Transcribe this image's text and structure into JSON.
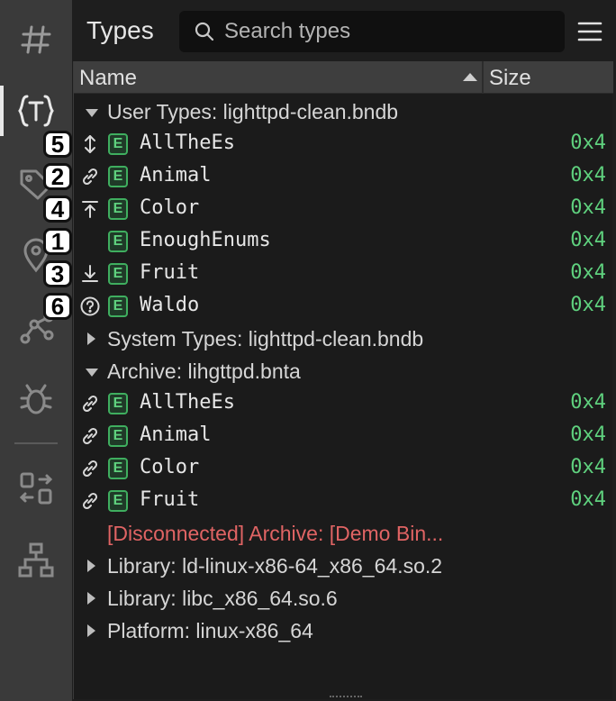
{
  "panel": {
    "title": "Types",
    "search_placeholder": "Search types",
    "menu_icon": "hamburger-menu-icon"
  },
  "rail": {
    "icons": [
      "hash-icon",
      "types-icon",
      "tag-icon",
      "location-pin-icon",
      "graph-nodes-icon",
      "bug-icon",
      "transfer-icon",
      "hierarchy-icon"
    ],
    "active": "types-icon"
  },
  "columns": {
    "name": "Name",
    "size": "Size",
    "sort": "ascending"
  },
  "groups": {
    "user": "User Types: lighttpd-clean.bndb",
    "system": "System Types: lighttpd-clean.bndb",
    "archive": "Archive: lihgttpd.bnta",
    "disconnected": "[Disconnected] Archive: [Demo Bin...",
    "lib1": "Library: ld-linux-x86-64_x86_64.so.2",
    "lib2": "Library: libc_x86_64.so.6",
    "platform": "Platform: linux-x86_64"
  },
  "user_types": [
    {
      "name": "AllTheEs",
      "size": "0x4",
      "status": "sync-both-icon",
      "kind": "E",
      "callout": "5"
    },
    {
      "name": "Animal",
      "size": "0x4",
      "status": "link-icon",
      "kind": "E",
      "callout": "2"
    },
    {
      "name": "Color",
      "size": "0x4",
      "status": "push-up-icon",
      "kind": "E",
      "callout": "4"
    },
    {
      "name": "EnoughEnums",
      "size": "0x4",
      "status": "",
      "kind": "E",
      "callout": "1"
    },
    {
      "name": "Fruit",
      "size": "0x4",
      "status": "pull-down-icon",
      "kind": "E",
      "callout": "3"
    },
    {
      "name": "Waldo",
      "size": "0x4",
      "status": "question-icon",
      "kind": "E",
      "callout": "6"
    }
  ],
  "archive_types": [
    {
      "name": "AllTheEs",
      "size": "0x4",
      "status": "link-icon",
      "kind": "E"
    },
    {
      "name": "Animal",
      "size": "0x4",
      "status": "link-icon",
      "kind": "E"
    },
    {
      "name": "Color",
      "size": "0x4",
      "status": "link-icon",
      "kind": "E"
    },
    {
      "name": "Fruit",
      "size": "0x4",
      "status": "link-icon",
      "kind": "E"
    }
  ],
  "colors": {
    "accent_green": "#5fd17e",
    "disconnected_red": "#e06464",
    "background": "#1b1b1b",
    "rail": "#3a3a3a"
  }
}
